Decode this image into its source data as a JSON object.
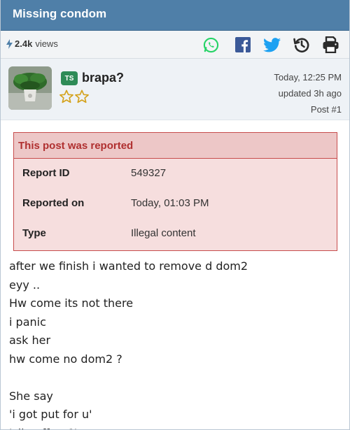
{
  "thread": {
    "title": "Missing condom"
  },
  "toolbar": {
    "views_count": "2.4k",
    "views_label": "views",
    "icons": [
      "whatsapp-icon",
      "facebook-icon",
      "twitter-icon",
      "history-icon",
      "print-icon"
    ]
  },
  "post": {
    "badge": "TS",
    "username": "brapa?",
    "stars": 2,
    "time": "Today, 12:25 PM",
    "updated": "updated 3h ago",
    "number": "Post #1"
  },
  "report": {
    "heading": "This post was reported",
    "rows": [
      {
        "label": "Report ID",
        "value": "549327"
      },
      {
        "label": "Reported on",
        "value": "Today, 01:03 PM"
      },
      {
        "label": "Type",
        "value": "Illegal content"
      }
    ]
  },
  "body": {
    "lines": [
      "after we finish i wanted to remove d dom2",
      "eyy ..",
      "Hw come its not there",
      "i panic",
      "ask her",
      "hw come no dom2 ?",
      "",
      "She say",
      "'i got put for u'",
      "'slip off or ?'"
    ]
  },
  "colors": {
    "titlebar": "#4f7fa8",
    "report_border": "#c74c4c",
    "report_heading": "#b03030",
    "badge": "#2e8b57",
    "whatsapp": "#25d366",
    "facebook": "#3b5998",
    "twitter": "#1da1f2"
  }
}
